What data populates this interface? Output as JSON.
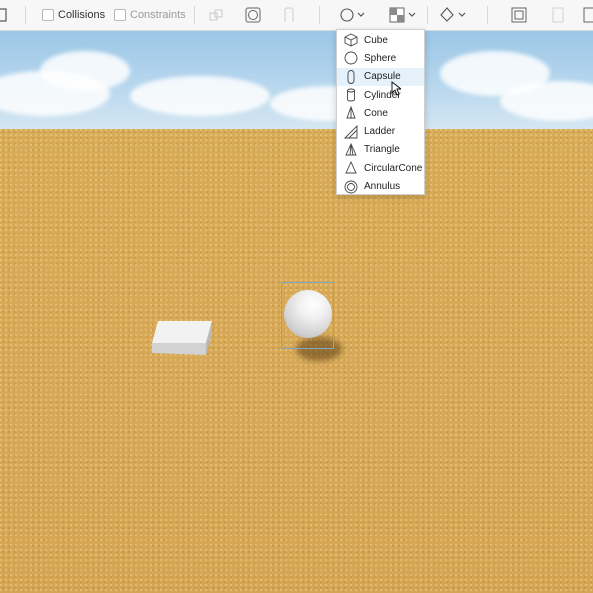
{
  "toolbar": {
    "collisions_label": "Collisions",
    "constraints_label": "Constraints"
  },
  "menu": {
    "items": [
      {
        "label": "Cube",
        "icon": "cube-icon"
      },
      {
        "label": "Sphere",
        "icon": "sphere-icon"
      },
      {
        "label": "Capsule",
        "icon": "capsule-icon"
      },
      {
        "label": "Cylinder",
        "icon": "cylinder-icon"
      },
      {
        "label": "Cone",
        "icon": "cone-icon"
      },
      {
        "label": "Ladder",
        "icon": "ladder-icon"
      },
      {
        "label": "Triangle",
        "icon": "triangle-icon"
      },
      {
        "label": "CircularCone",
        "icon": "circular-cone-icon"
      },
      {
        "label": "Annulus",
        "icon": "annulus-icon"
      }
    ],
    "hovered_item": "Capsule"
  },
  "colors": {
    "hover": "#e5f1fb",
    "selection": "#7fa6c2",
    "ground": "#d7a857"
  }
}
